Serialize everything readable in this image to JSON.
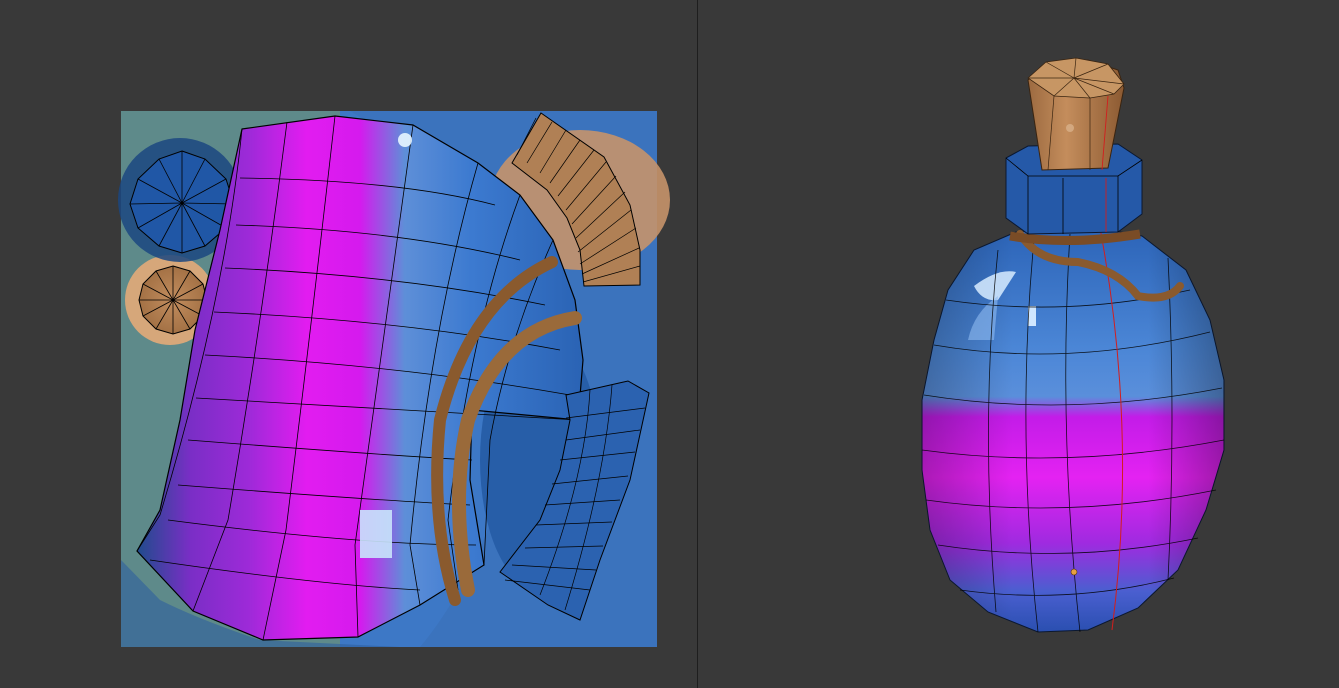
{
  "colors": {
    "editor_background": "#393939",
    "pane_divider": "#1e1e1e",
    "potion_blue": "#3a78c9",
    "potion_dark_blue": "#1d4f94",
    "potion_magenta": "#d613ee",
    "potion_purple": "#8a2bd0",
    "cork": "#b9845a",
    "rope": "#8a5a2e",
    "background_teal": "#5e8a8a",
    "wire_edge": "#000000",
    "seam_edge": "#d21e1e"
  },
  "icons": {
    "uv_editor": "uv-texture-image",
    "viewport": "potion-bottle-model"
  }
}
